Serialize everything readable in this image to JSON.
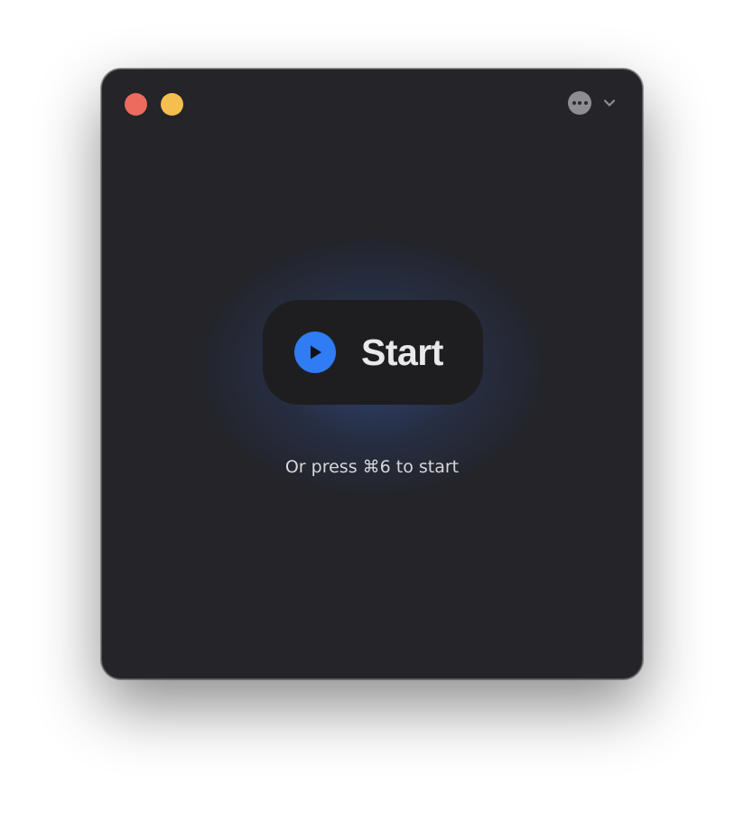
{
  "window": {
    "traffic_lights": [
      "close",
      "minimize"
    ],
    "menu": {
      "icon": "ellipsis-circle-icon",
      "chevron": "chevron-down-icon"
    }
  },
  "main": {
    "start_label": "Start",
    "start_icon": "play-icon",
    "hint": "Or press ⌘6 to start"
  },
  "colors": {
    "accent": "#2f7cf5",
    "close": "#ec6a5e",
    "minimize": "#f4bf4f",
    "window_bg": "#242429",
    "button_bg": "#1e1e20"
  }
}
